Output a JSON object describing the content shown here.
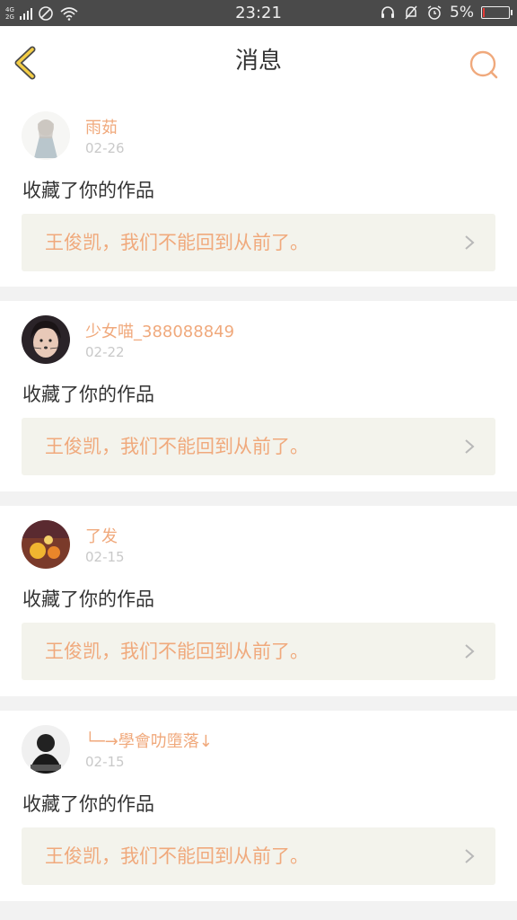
{
  "status_bar": {
    "network_top": "4G",
    "network_bottom": "2G",
    "time": "23:21",
    "battery_text": "5%",
    "battery_level": 0.05,
    "icons": [
      "signal-icon",
      "no-sim-icon",
      "wifi-icon",
      "headset-icon",
      "mute-bell-icon",
      "alarm-icon",
      "battery-icon"
    ]
  },
  "header": {
    "title": "消息",
    "back_icon": "chevron-left-icon",
    "search_icon": "search-icon",
    "accent_color": "#f0a97c"
  },
  "messages": [
    {
      "username": "雨茹",
      "date": "02-26",
      "action": "收藏了你的作品",
      "work_title": "王俊凯，我们不能回到从前了。"
    },
    {
      "username": "少女喵_388088849",
      "date": "02-22",
      "action": "收藏了你的作品",
      "work_title": "王俊凯，我们不能回到从前了。"
    },
    {
      "username": "了发",
      "date": "02-15",
      "action": "收藏了你的作品",
      "work_title": "王俊凯，我们不能回到从前了。"
    },
    {
      "username": "└─→學會叻墮落↓",
      "date": "02-15",
      "action": "收藏了你的作品",
      "work_title": "王俊凯，我们不能回到从前了。"
    }
  ]
}
